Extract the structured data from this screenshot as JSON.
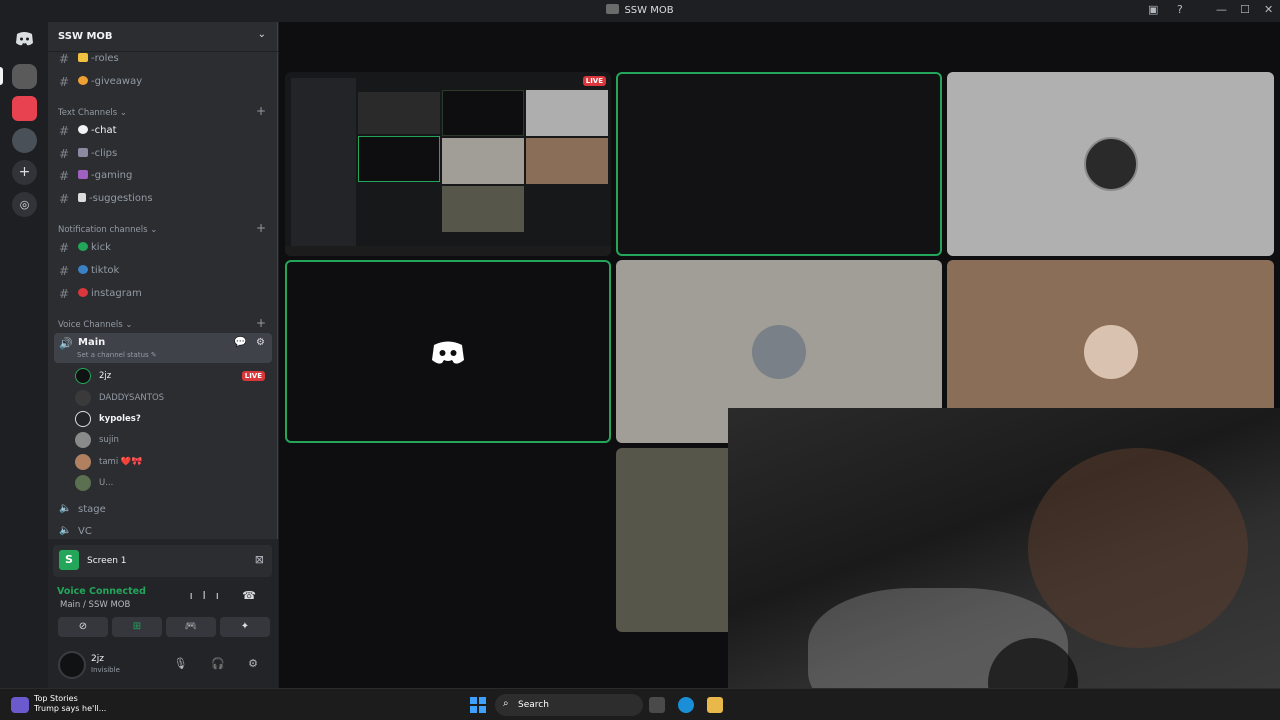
{
  "window": {
    "title": "SSW MOB",
    "controls": {
      "inbox": "▣",
      "help": "?",
      "minimize": "—",
      "maximize": "☐",
      "close": "✕"
    }
  },
  "server": {
    "name": "SSW MOB",
    "menu_chevron": "⌄"
  },
  "channels_top": [
    {
      "label": "-roles",
      "emoji_color": "#f0c040"
    },
    {
      "label": "-giveaway",
      "emoji_color": "#f0a030"
    }
  ],
  "categories": {
    "text": "Text Channels ⌄",
    "notification": "Notification channels ⌄",
    "voice": "Voice Channels ⌄",
    "add": "+"
  },
  "text_channels": [
    {
      "label": "-chat",
      "emoji_color": "#f2f3f5",
      "active": true
    },
    {
      "label": "-clips",
      "emoji_color": "#8a8aa0",
      "active": false
    },
    {
      "label": "-gaming",
      "emoji_color": "#a060c0",
      "active": false
    },
    {
      "label": "-suggestions",
      "emoji_color": "#dcdcdc",
      "active": false
    }
  ],
  "notification_channels": [
    {
      "label": "kick",
      "dot_color": "#23a55a"
    },
    {
      "label": "tiktok",
      "dot_color": "#3b82c4"
    },
    {
      "label": "instagram",
      "dot_color": "#da373c"
    }
  ],
  "voice_main": {
    "name": "Main",
    "status": "Set a channel status ✎",
    "actions": "💬 ⚙"
  },
  "voice_users": [
    {
      "name": "2jz",
      "live": "LIVE",
      "bold": false,
      "avatar_color": "#111214"
    },
    {
      "name": "DADDYSANTOS",
      "live": "",
      "bold": false,
      "avatar_color": "#3a3a3a"
    },
    {
      "name": "kypoles?",
      "live": "",
      "bold": true,
      "avatar_color": "#232428"
    },
    {
      "name": "sujin",
      "live": "",
      "bold": false,
      "avatar_color": "#8a8a8a"
    },
    {
      "name": "tami ❤️🎀",
      "live": "",
      "bold": false,
      "avatar_color": "#b08060"
    },
    {
      "name": "U...",
      "live": "",
      "bold": false,
      "avatar_color": "#5a7050"
    }
  ],
  "other_voice": [
    {
      "label": "stage"
    },
    {
      "label": "VC"
    }
  ],
  "stream_card": {
    "icon_letter": "S",
    "label": "Screen 1",
    "close": "⊠"
  },
  "voice_status": {
    "title": "Voice Connected",
    "location": "Main / SSW MOB",
    "icons": "ılı ☎"
  },
  "panel_buttons": [
    {
      "name": "camera-off",
      "glyph": "⊘",
      "on": false
    },
    {
      "name": "screen-share",
      "glyph": "⊞",
      "on": true
    },
    {
      "name": "activities",
      "glyph": "🎮",
      "on": false
    },
    {
      "name": "soundboard",
      "glyph": "✦",
      "on": false
    }
  ],
  "user": {
    "name": "2jz",
    "status": "Invisible",
    "controls": "🎙 🎧 ⚙"
  },
  "tiles": {
    "live_label": "LIVE",
    "tile_colors": [
      "#0e0e10",
      "#b0b0b0",
      "#0e0e10",
      "#a09e96",
      "#8a6e58",
      "#56564a"
    ]
  },
  "taskbar": {
    "news_title": "Top Stories",
    "news_text": "Trump says he'll...",
    "search_label": "Search",
    "search_icon": "⌕"
  }
}
